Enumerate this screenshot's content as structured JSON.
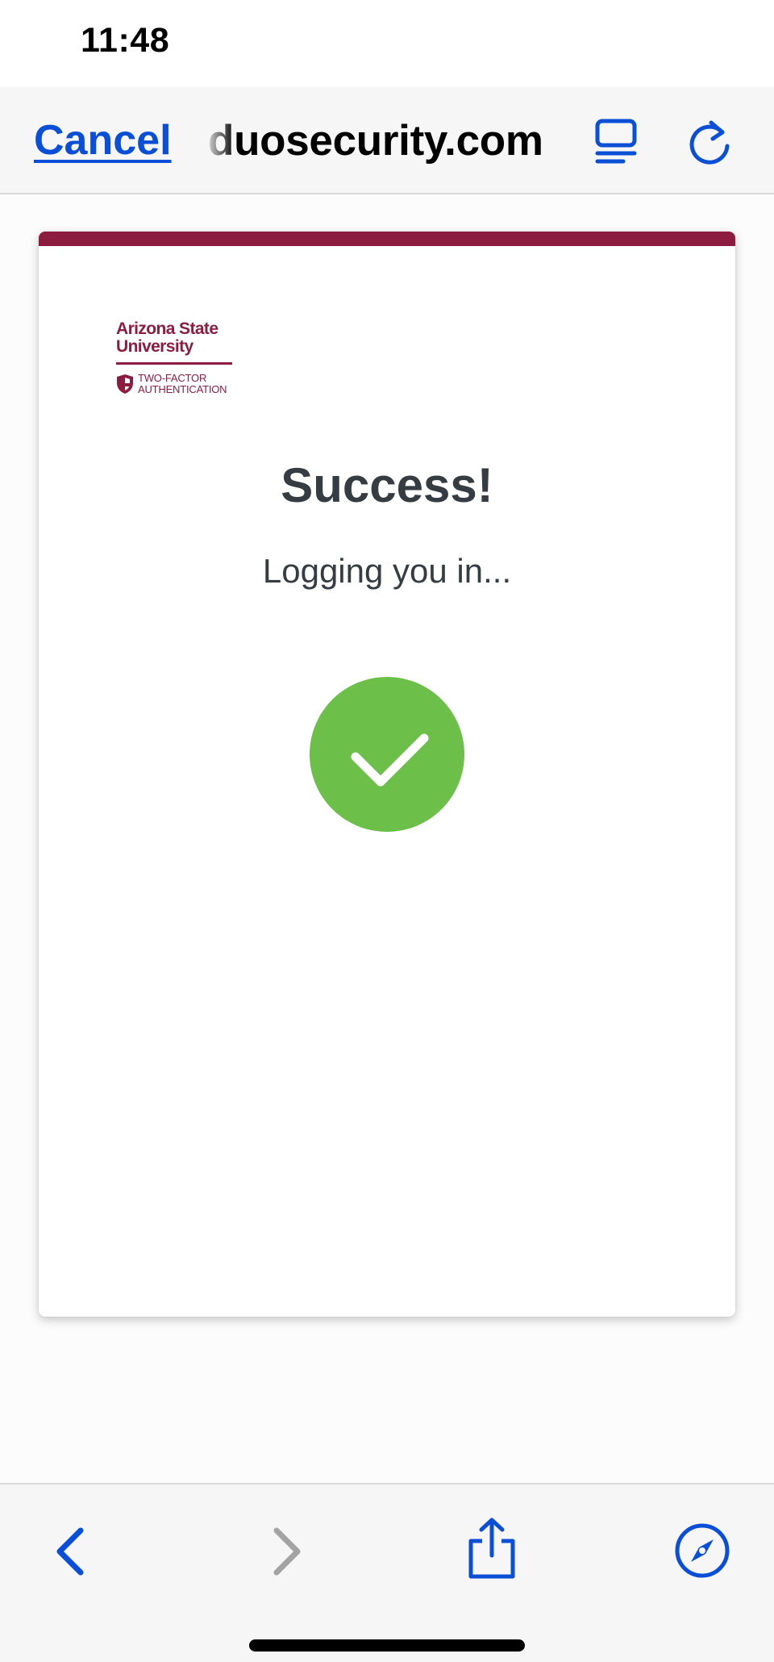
{
  "status_bar": {
    "time": "11:48"
  },
  "nav_bar": {
    "cancel_label": "Cancel",
    "url": "duosecurity.com",
    "reader_icon": "reader-mode-icon",
    "reload_icon": "reload-icon"
  },
  "card": {
    "accent_color": "#8c1d40",
    "logo": {
      "name_line1": "Arizona State",
      "name_line2": "University",
      "sub_line1": "TWO-FACTOR",
      "sub_line2": "AUTHENTICATION"
    },
    "title": "Success!",
    "subtitle": "Logging you in...",
    "status_icon": "checkmark-icon",
    "status_color": "#6cc04a"
  },
  "toolbar": {
    "items": [
      {
        "icon": "back-chevron-icon",
        "enabled": true
      },
      {
        "icon": "forward-chevron-icon",
        "enabled": false
      },
      {
        "icon": "share-icon",
        "enabled": true
      },
      {
        "icon": "compass-icon",
        "enabled": true
      }
    ],
    "accent_color": "#0a4fd6"
  }
}
